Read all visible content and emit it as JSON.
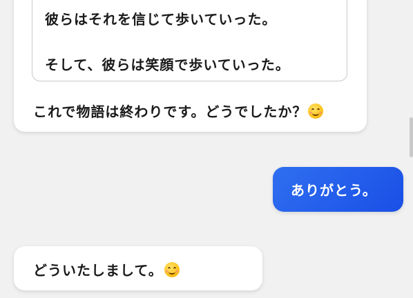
{
  "messages": [
    {
      "role": "assistant",
      "quote_lines": [
        "彼らはそれを信じて歩いていった。",
        "そして、彼らは笑顔で歩いていった。"
      ],
      "text": "これで物語は終わりです。どうでしたか？",
      "emoji": "smiling-face"
    },
    {
      "role": "user",
      "text": "ありがとう。"
    },
    {
      "role": "assistant",
      "text": "どういたしまして。",
      "emoji": "smiling-face"
    }
  ],
  "colors": {
    "background": "#f1f1f1",
    "assistant_bubble": "#ffffff",
    "user_bubble_start": "#2f6ff0",
    "user_bubble_end": "#1a4fe6",
    "text": "#1a1a1a"
  }
}
